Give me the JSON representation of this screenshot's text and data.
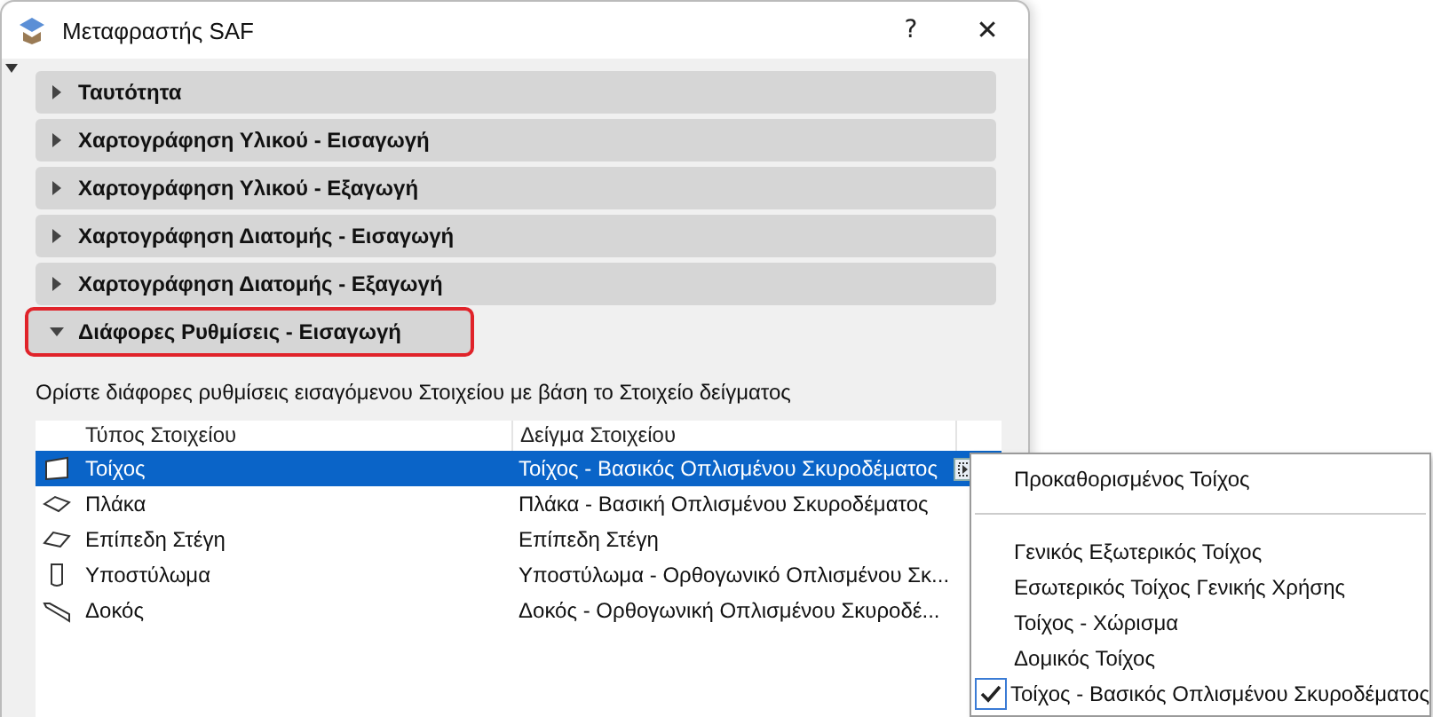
{
  "window": {
    "title": "Μεταφραστής SAF",
    "help": "?",
    "close": "✕"
  },
  "sections": [
    {
      "label": "Ταυτότητα",
      "expanded": false,
      "highlighted": false
    },
    {
      "label": "Χαρτογράφηση Υλικού - Εισαγωγή",
      "expanded": false,
      "highlighted": false
    },
    {
      "label": "Χαρτογράφηση Υλικού - Εξαγωγή",
      "expanded": false,
      "highlighted": false
    },
    {
      "label": "Χαρτογράφηση Διατομής - Εισαγωγή",
      "expanded": false,
      "highlighted": false
    },
    {
      "label": "Χαρτογράφηση Διατομής - Εξαγωγή",
      "expanded": false,
      "highlighted": false
    },
    {
      "label": "Διάφορες Ρυθμίσεις - Εισαγωγή",
      "expanded": true,
      "highlighted": true
    }
  ],
  "description": "Ορίστε διάφορες ρυθμίσεις εισαγόμενου Στοιχείου με βάση το Στοιχείο δείγματος",
  "table": {
    "columns": [
      "Τύπος Στοιχείου",
      "Δείγμα Στοιχείου"
    ],
    "rows": [
      {
        "kind": "wall",
        "type": "Τοίχος",
        "sample": "Τοίχος - Βασικός Οπλισμένου Σκυροδέματος",
        "selected": true
      },
      {
        "kind": "slab",
        "type": "Πλάκα",
        "sample": "Πλάκα - Βασική Οπλισμένου Σκυροδέματος",
        "selected": false
      },
      {
        "kind": "roof",
        "type": "Επίπεδη Στέγη",
        "sample": "Επίπεδη Στέγη",
        "selected": false
      },
      {
        "kind": "column",
        "type": "Υποστύλωμα",
        "sample": "Υποστύλωμα - Ορθογωνικό Οπλισμένου Σκ...",
        "selected": false
      },
      {
        "kind": "beam",
        "type": "Δοκός",
        "sample": "Δοκός - Ορθογωνική Οπλισμένου Σκυροδέ...",
        "selected": false
      }
    ]
  },
  "menu": {
    "groups": [
      [
        {
          "label": "Προκαθορισμένος Τοίχος",
          "checked": false
        }
      ],
      [
        {
          "label": "Γενικός Εξωτερικός Τοίχος",
          "checked": false
        },
        {
          "label": "Εσωτερικός Τοίχος Γενικής Χρήσης",
          "checked": false
        },
        {
          "label": "Τοίχος - Χώρισμα",
          "checked": false
        },
        {
          "label": "Δομικός Τοίχος",
          "checked": false
        },
        {
          "label": "Τοίχος - Βασικός Οπλισμένου Σκυροδέματος",
          "checked": true
        }
      ]
    ]
  }
}
